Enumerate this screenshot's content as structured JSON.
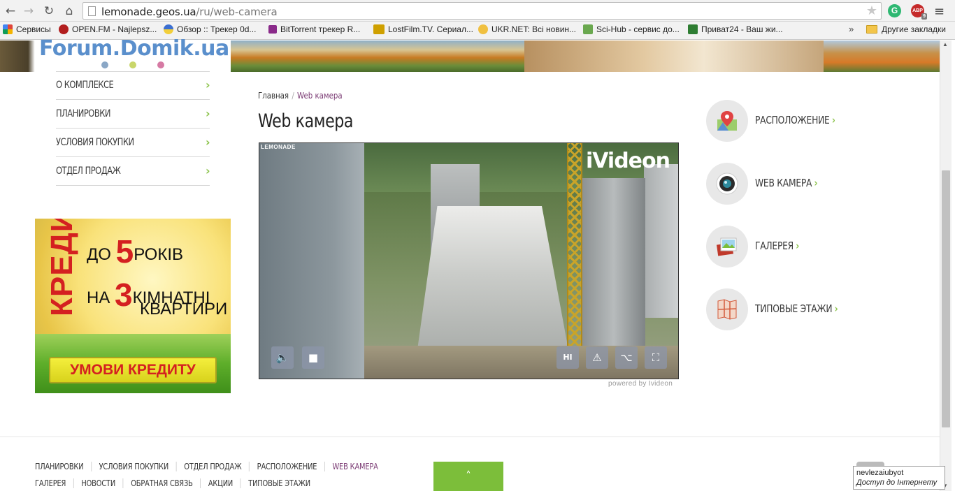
{
  "browser": {
    "url_host": "lemonade.geos.ua",
    "url_path": "/ru/web-camera",
    "back_icon": "←",
    "forward_icon": "→",
    "reload_icon": "↻",
    "home_icon": "⌂",
    "star_icon": "★",
    "menu_icon": "≡",
    "abp_label": "ABP",
    "abp_badge": "9",
    "green_ext_label": "G"
  },
  "bookmarks": {
    "items": [
      {
        "label": "Сервисы",
        "icon": "apps-grid-icon",
        "color": "#e0463a"
      },
      {
        "label": "OPEN.FM - Najlepsz...",
        "icon": "openfm-icon",
        "color": "#b21e1e"
      },
      {
        "label": "Обзор :: Трекер 0d...",
        "icon": "tracker-icon",
        "color": "#e2b83a"
      },
      {
        "label": "BitTorrent трекер R...",
        "icon": "bittorrent-icon",
        "color": "#8a2a8a"
      },
      {
        "label": "LostFilm.TV. Сериал...",
        "icon": "lostfilm-icon",
        "color": "#cfa000"
      },
      {
        "label": "UKR.NET: Всі новин...",
        "icon": "ukrnet-icon",
        "color": "#f0c040"
      },
      {
        "label": "Sci-Hub - сервис до...",
        "icon": "scihub-icon",
        "color": "#6aa84f"
      },
      {
        "label": "Приват24 - Ваш жи...",
        "icon": "privat24-icon",
        "color": "#2e7d32"
      }
    ],
    "more": "»",
    "other_label": "Другие закладки"
  },
  "header": {
    "logo_text": "Forum.Domik.ua",
    "dot_colors": [
      "#8aa7c6",
      "#c9d66a",
      "#d67aa4"
    ]
  },
  "left_menu": {
    "items": [
      {
        "label": "О КОМПЛЕКСЕ",
        "chev": "›"
      },
      {
        "label": "ПЛАНИРОВКИ",
        "chev": "›"
      },
      {
        "label": "УСЛОВИЯ ПОКУПКИ",
        "chev": "›"
      },
      {
        "label": "ОТДЕЛ ПРОДАЖ",
        "chev": "›"
      }
    ]
  },
  "promo": {
    "vertical": "КРЕДИТ",
    "line1_pre": "ДО ",
    "line1_num": "5",
    "line1_post": "РОКІВ",
    "line2_pre": "НА ",
    "line2_num": "3",
    "line2_post": "КІМНАТНІ",
    "line3": "КВАРТИРИ",
    "cta": "УМОВИ КРЕДИТУ"
  },
  "main": {
    "breadcrumb_home": "Главная",
    "breadcrumb_sep": "/",
    "breadcrumb_current": "Web камера",
    "title": "Web камера"
  },
  "player": {
    "cam_label": "LEMONADE",
    "logo": "iVideon",
    "sound_icon": "🔈",
    "stop_icon": "■",
    "hd_label": "HI",
    "alert_icon": "⚠",
    "share_icon": "⌥",
    "fullscreen_icon": "⛶",
    "powered": "powered by Ivideon"
  },
  "right_menu": {
    "items": [
      {
        "label": "РАСПОЛОЖЕНИЕ",
        "chev": "›",
        "icon": "map-pin-icon"
      },
      {
        "label": "WEB КАМЕРА",
        "chev": "›",
        "icon": "webcam-icon"
      },
      {
        "label": "ГАЛЕРЕЯ",
        "chev": "›",
        "icon": "gallery-icon"
      },
      {
        "label": "ТИПОВЫЕ ЭТАЖИ",
        "chev": "›",
        "icon": "floorplan-icon"
      }
    ]
  },
  "footer": {
    "row1": [
      "ПЛАНИРОВКИ",
      "УСЛОВИЯ ПОКУПКИ",
      "ОТДЕЛ ПРОДАЖ",
      "РАСПОЛОЖЕНИЕ",
      "WEB КАМЕРА"
    ],
    "row2": [
      "ГАЛЕРЕЯ",
      "НОВОСТИ",
      "ОБРАТНАЯ СВЯЗЬ",
      "АКЦИИ",
      "ТИПОВЫЕ ЭТАЖИ"
    ],
    "scroll_top_icon": "˄"
  },
  "status": {
    "line1": "nevlezaiubyot",
    "line2": "Доступ до Інтернету"
  },
  "colors": {
    "accent_green": "#8bc34a",
    "active_purple": "#7b3b74",
    "logo_blue": "#5a8fcc"
  }
}
